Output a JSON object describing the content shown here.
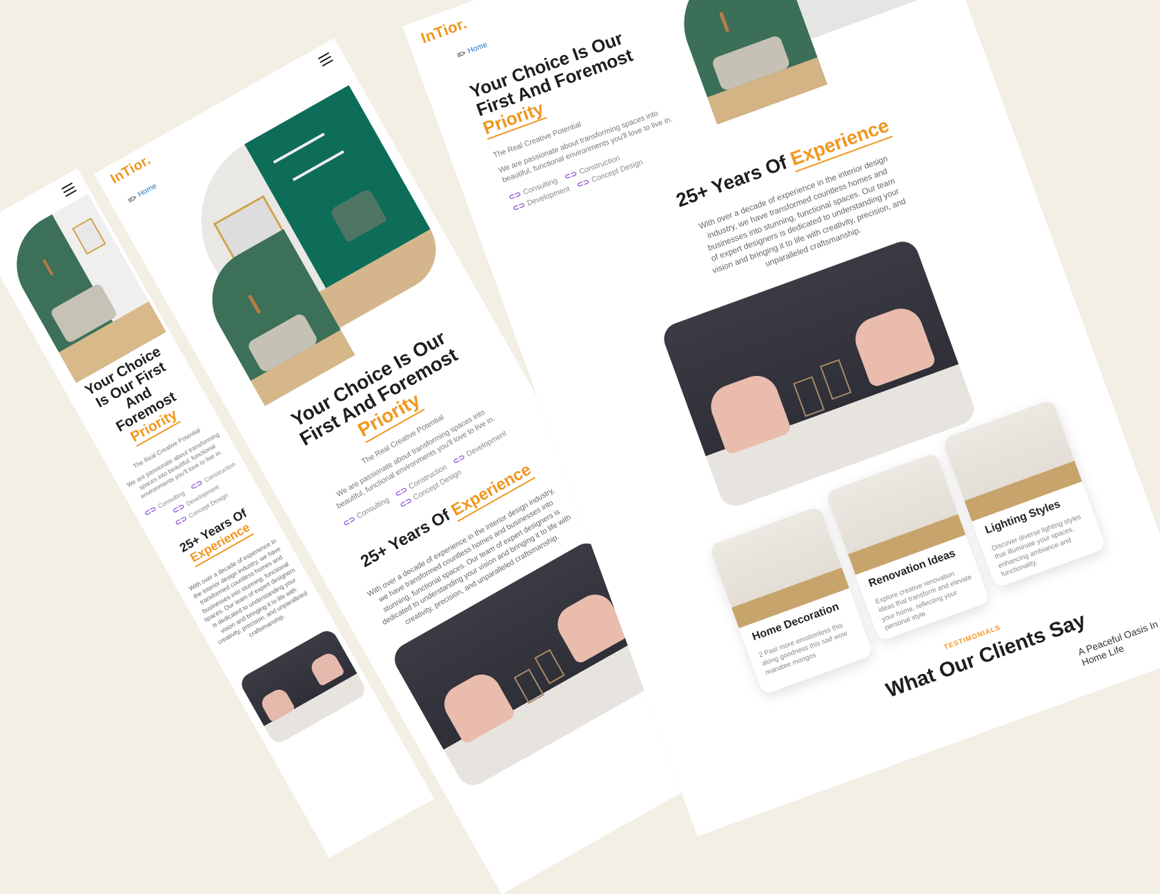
{
  "theme": {
    "background": "#f3efe5",
    "accent": "#f0961f",
    "link": "#2a78c8",
    "icon_purple": "#8b4fd6"
  },
  "brand": {
    "logo": "InTior."
  },
  "nav": {
    "breadcrumb_icon": "menu-arrow-icon",
    "breadcrumb": "Home",
    "menu_icon": "hamburger-icon"
  },
  "hero": {
    "title_line1": "Your Choice Is Our",
    "title_line2": "First And Foremost",
    "title_highlight": "Priority",
    "narrow_line1": "Your Choice",
    "narrow_line2": "Is Our First",
    "narrow_line3": "And",
    "narrow_line4": "Foremost",
    "subtitle": "The Real Creative Potential",
    "description": "We are passionate about transforming spaces into beautiful, functional environments you'll love to live in.",
    "services": [
      "Consulting",
      "Construction",
      "Development",
      "Concept Design"
    ]
  },
  "experience": {
    "title_prefix": "25+ Years Of",
    "title_highlight": "Experience",
    "text": "With over a decade of experience in the interior design industry, we have transformed countless homes and businesses into stunning, functional spaces. Our team of expert designers is dedicated to understanding your vision and bringing it to life with creativity, precision, and unparalleled craftsmanship."
  },
  "cards": [
    {
      "title": "Home Decoration",
      "text": "2 Past more emotionless this along goodness this sad wow manatee mongos"
    },
    {
      "title": "Renovation Ideas",
      "text": "Explore creative renovation ideas that transform and elevate your home, reflecting your personal style."
    },
    {
      "title": "Lighting Styles",
      "text": "Discover diverse lighting styles that illuminate your spaces, enhancing ambiance and functionality."
    }
  ],
  "testimonials": {
    "label": "TESTIMONIALS",
    "title": "What Our Clients Say",
    "preview_title": "A Peaceful Oasis In My Home Life"
  }
}
